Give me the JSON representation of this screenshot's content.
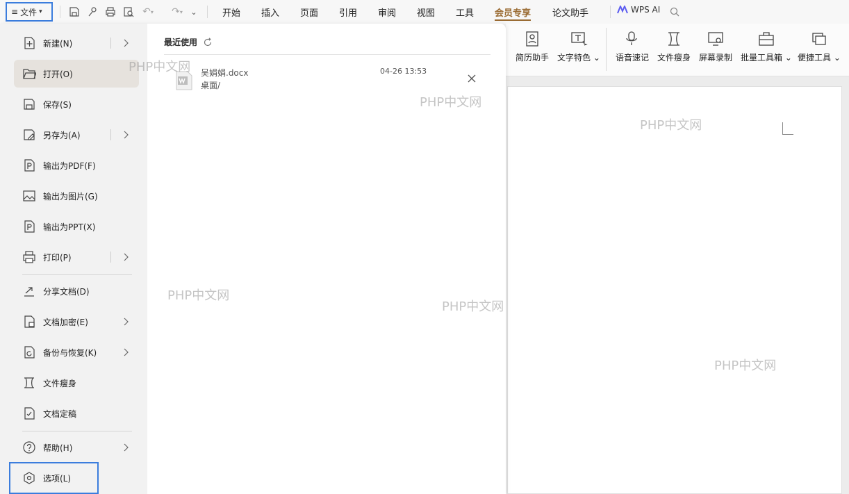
{
  "topbar": {
    "file_label": "文件",
    "tabs": [
      "开始",
      "插入",
      "页面",
      "引用",
      "审阅",
      "视图",
      "工具",
      "会员专享",
      "论文助手"
    ],
    "active_tab": "会员专享",
    "wps_ai": "WPS AI"
  },
  "ribbon": {
    "items": [
      "简历助手",
      "文字特色",
      "语音速记",
      "文件瘦身",
      "屏幕录制",
      "批量工具箱",
      "便捷工具"
    ]
  },
  "file_menu": {
    "items": [
      {
        "label": "新建(N)",
        "icon": "new-icon",
        "submenu": true
      },
      {
        "label": "打开(O)",
        "icon": "folder-open-icon",
        "submenu": false
      },
      {
        "label": "保存(S)",
        "icon": "save-icon",
        "submenu": false
      },
      {
        "label": "另存为(A)",
        "icon": "save-as-icon",
        "submenu": true
      },
      {
        "label": "输出为PDF(F)",
        "icon": "export-pdf-icon",
        "submenu": false
      },
      {
        "label": "输出为图片(G)",
        "icon": "export-image-icon",
        "submenu": false
      },
      {
        "label": "输出为PPT(X)",
        "icon": "export-ppt-icon",
        "submenu": false
      },
      {
        "label": "打印(P)",
        "icon": "print-icon",
        "submenu": true
      },
      {
        "label": "分享文档(D)",
        "icon": "share-icon",
        "submenu": false
      },
      {
        "label": "文档加密(E)",
        "icon": "lock-icon",
        "submenu": true
      },
      {
        "label": "备份与恢复(K)",
        "icon": "backup-icon",
        "submenu": true
      },
      {
        "label": "文件瘦身",
        "icon": "slim-icon",
        "submenu": false
      },
      {
        "label": "文档定稿",
        "icon": "finalize-icon",
        "submenu": false
      },
      {
        "label": "帮助(H)",
        "icon": "help-icon",
        "submenu": true
      },
      {
        "label": "选项(L)",
        "icon": "options-icon",
        "submenu": false
      }
    ],
    "selected": "打开(O)"
  },
  "recent": {
    "title": "最近使用",
    "files": [
      {
        "name": "吴娟娟.docx",
        "path": "桌面/",
        "time": "04-26 13:53"
      }
    ]
  },
  "watermark": "PHP中文网"
}
